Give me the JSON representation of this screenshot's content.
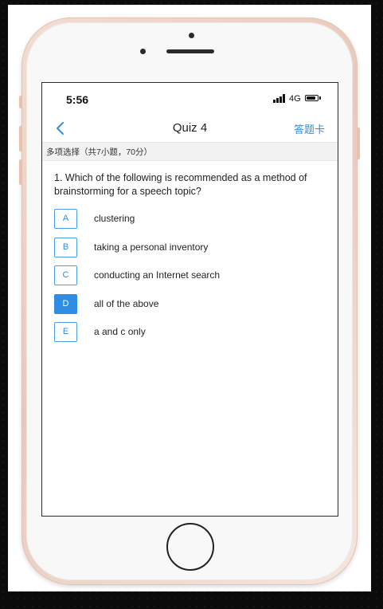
{
  "status_bar": {
    "time": "5:56",
    "network": "4G"
  },
  "nav": {
    "title": "Quiz 4",
    "answer_sheet": "答题卡"
  },
  "section": {
    "header": "多项选择（共7小题，70分）"
  },
  "question": {
    "text": "1. Which of the following is recommended as a method of brainstorming for a speech topic?"
  },
  "options": [
    {
      "letter": "A",
      "text": "clustering",
      "selected": false
    },
    {
      "letter": "B",
      "text": "taking a personal inventory",
      "selected": false
    },
    {
      "letter": "C",
      "text": "conducting an Internet search",
      "selected": false
    },
    {
      "letter": "D",
      "text": "all of the above",
      "selected": true
    },
    {
      "letter": "E",
      "text": "a and c only",
      "selected": false
    }
  ],
  "colors": {
    "accent": "#2f8de4",
    "phone_frame": "#e9c8bb"
  },
  "icons": {
    "back": "chevron-left-icon",
    "signal": "signal-bars-icon",
    "battery": "battery-icon"
  }
}
